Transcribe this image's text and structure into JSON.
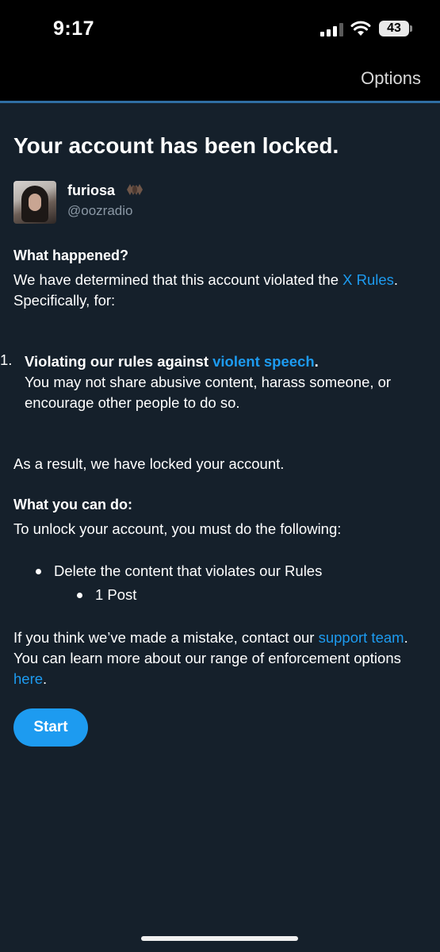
{
  "status_bar": {
    "time": "9:17",
    "battery": "43"
  },
  "header": {
    "options_label": "Options"
  },
  "page": {
    "title": "Your account has been locked."
  },
  "user": {
    "name": "furiosa",
    "handle": "@oozradio"
  },
  "what_happened": {
    "heading": "What happened?",
    "text_before_link": "We have determined that this account violated the ",
    "link_text": "X Rules",
    "text_after_link": ". Specifically, for:"
  },
  "violations": [
    {
      "number": "1.",
      "title_before": "Violating our rules against ",
      "title_link": "violent speech",
      "title_after": ".",
      "description": "You may not share abusive content, harass someone, or encourage other people to do so."
    }
  ],
  "result_text": "As a result, we have locked your account.",
  "what_you_can_do": {
    "heading": "What you can do:",
    "text": "To unlock your account, you must do the following:",
    "steps": [
      "Delete the content that violates our Rules"
    ],
    "substeps": [
      "1 Post"
    ]
  },
  "footer": {
    "text_1": "If you think we’ve made a mistake, contact our ",
    "link_1": "support team",
    "text_2": ". You can learn more about our range of enforcement options ",
    "link_2": "here",
    "text_3": "."
  },
  "start_button": {
    "label": "Start"
  },
  "colors": {
    "background": "#15202b",
    "accent": "#1d9bf0",
    "secondary_text": "#8b98a5"
  }
}
